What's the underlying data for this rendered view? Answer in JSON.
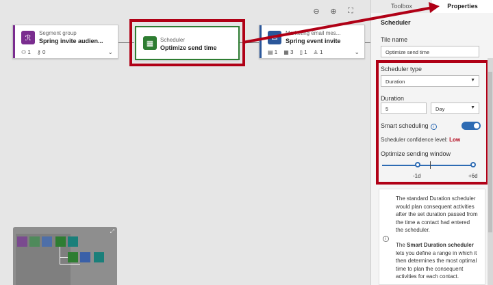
{
  "canvas": {
    "tiles": [
      {
        "type": "Segment group",
        "title": "Spring invite audien...",
        "stats": [
          "1",
          "0"
        ],
        "color": "#7a2d8f"
      },
      {
        "type": "Scheduler",
        "title": "Optimize send time",
        "color": "#2e7d32"
      },
      {
        "type": "Marketing email mes...",
        "title": "Spring event invite",
        "stats": [
          "1",
          "3",
          "1",
          "1"
        ],
        "color": "#2b579a"
      }
    ],
    "zoom_icons": [
      "zoom-out-icon",
      "zoom-in-icon",
      "fit-screen-icon"
    ]
  },
  "panel": {
    "tabs": [
      "Toolbox",
      "Properties"
    ],
    "active_tab": "Properties",
    "section_title": "Scheduler",
    "tile_name_label": "Tile name",
    "tile_name_value": "Optimize send time",
    "scheduler_type_label": "Scheduler type",
    "scheduler_type_value": "Duration",
    "duration_label": "Duration",
    "duration_value": "5",
    "duration_unit": "Day",
    "smart_scheduling_label": "Smart scheduling",
    "smart_scheduling_on": true,
    "confidence_label": "Scheduler confidence level:",
    "confidence_value": "Low",
    "window_label": "Optimize sending window",
    "window_min": "-1d",
    "window_max": "+6d",
    "info1": "The standard Duration scheduler would plan consequent activities after the set duration passed from the time a contact had entered the scheduler.",
    "info2_prefix": "The ",
    "info2_bold": "Smart Duration scheduler",
    "info2_rest": " lets you define a range in which it then determines the most optimal time to plan the consequent activities for each contact."
  },
  "colors": {
    "highlight": "#b00016",
    "accent": "#2d6bb3"
  }
}
